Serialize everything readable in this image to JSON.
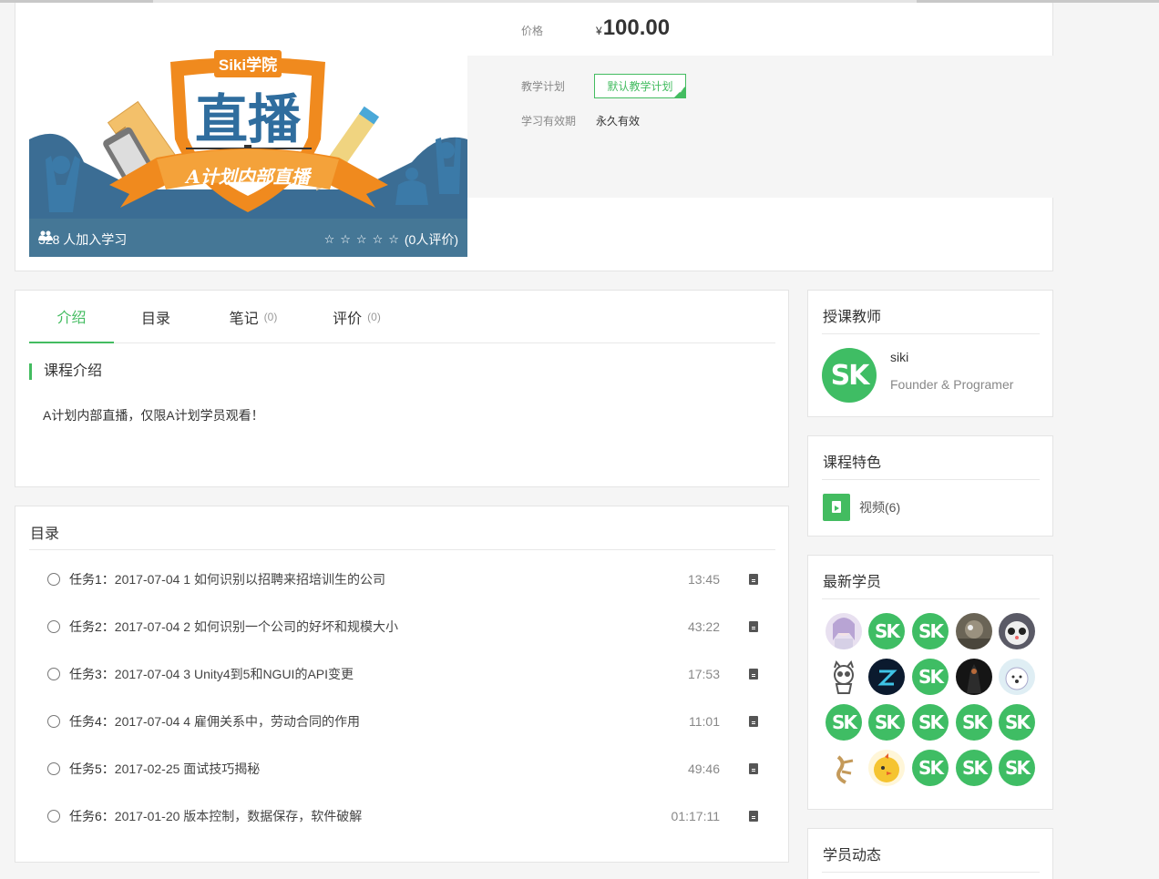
{
  "cover": {
    "learners": "328 人加入学习",
    "rating_text": "(0人评价)",
    "stars": 0,
    "banner_top": "Siki学院",
    "banner_main": "直播",
    "ribbon": "A计划内部直播"
  },
  "price": {
    "label": "价格",
    "currency": "¥",
    "value": "100.00"
  },
  "plan": {
    "label": "教学计划",
    "selected": "默认教学计划",
    "validity_label": "学习有效期",
    "validity_value": "永久有效"
  },
  "tabs": [
    {
      "label": "介绍",
      "count": ""
    },
    {
      "label": "目录",
      "count": ""
    },
    {
      "label": "笔记",
      "count": "(0)"
    },
    {
      "label": "评价",
      "count": "(0)"
    }
  ],
  "intro": {
    "title": "课程介绍",
    "text": "A计划内部直播，仅限A计划学员观看！"
  },
  "catalog": {
    "title": "目录",
    "tasks": [
      {
        "label": "任务1：",
        "name": "2017-07-04 1 如何识别以招聘来招培训生的公司",
        "duration": "13:45"
      },
      {
        "label": "任务2：",
        "name": "2017-07-04 2 如何识别一个公司的好坏和规模大小",
        "duration": "43:22"
      },
      {
        "label": "任务3：",
        "name": "2017-07-04 3 Unity4到5和NGUI的API变更",
        "duration": "17:53"
      },
      {
        "label": "任务4：",
        "name": "2017-07-04 4 雇佣关系中，劳动合同的作用",
        "duration": "11:01"
      },
      {
        "label": "任务5：",
        "name": "2017-02-25 面试技巧揭秘",
        "duration": "49:46"
      },
      {
        "label": "任务6：",
        "name": "2017-01-20 版本控制，数据保存，软件破解",
        "duration": "01:17:11"
      }
    ]
  },
  "teacher": {
    "title": "授课教师",
    "name": "siki",
    "role": "Founder & Programer",
    "avatar_text": "SK"
  },
  "features": {
    "title": "课程特色",
    "video": "视频(6)"
  },
  "students": {
    "title": "最新学员",
    "sk_text": "SK"
  },
  "activity": {
    "title": "学员动态"
  },
  "colors": {
    "accent": "#43bc60",
    "sk_green": "#3fbd64",
    "cover_bar": "#46789a",
    "shield_orange": "#f08a1e",
    "shield_blue": "#2f6d9e"
  }
}
